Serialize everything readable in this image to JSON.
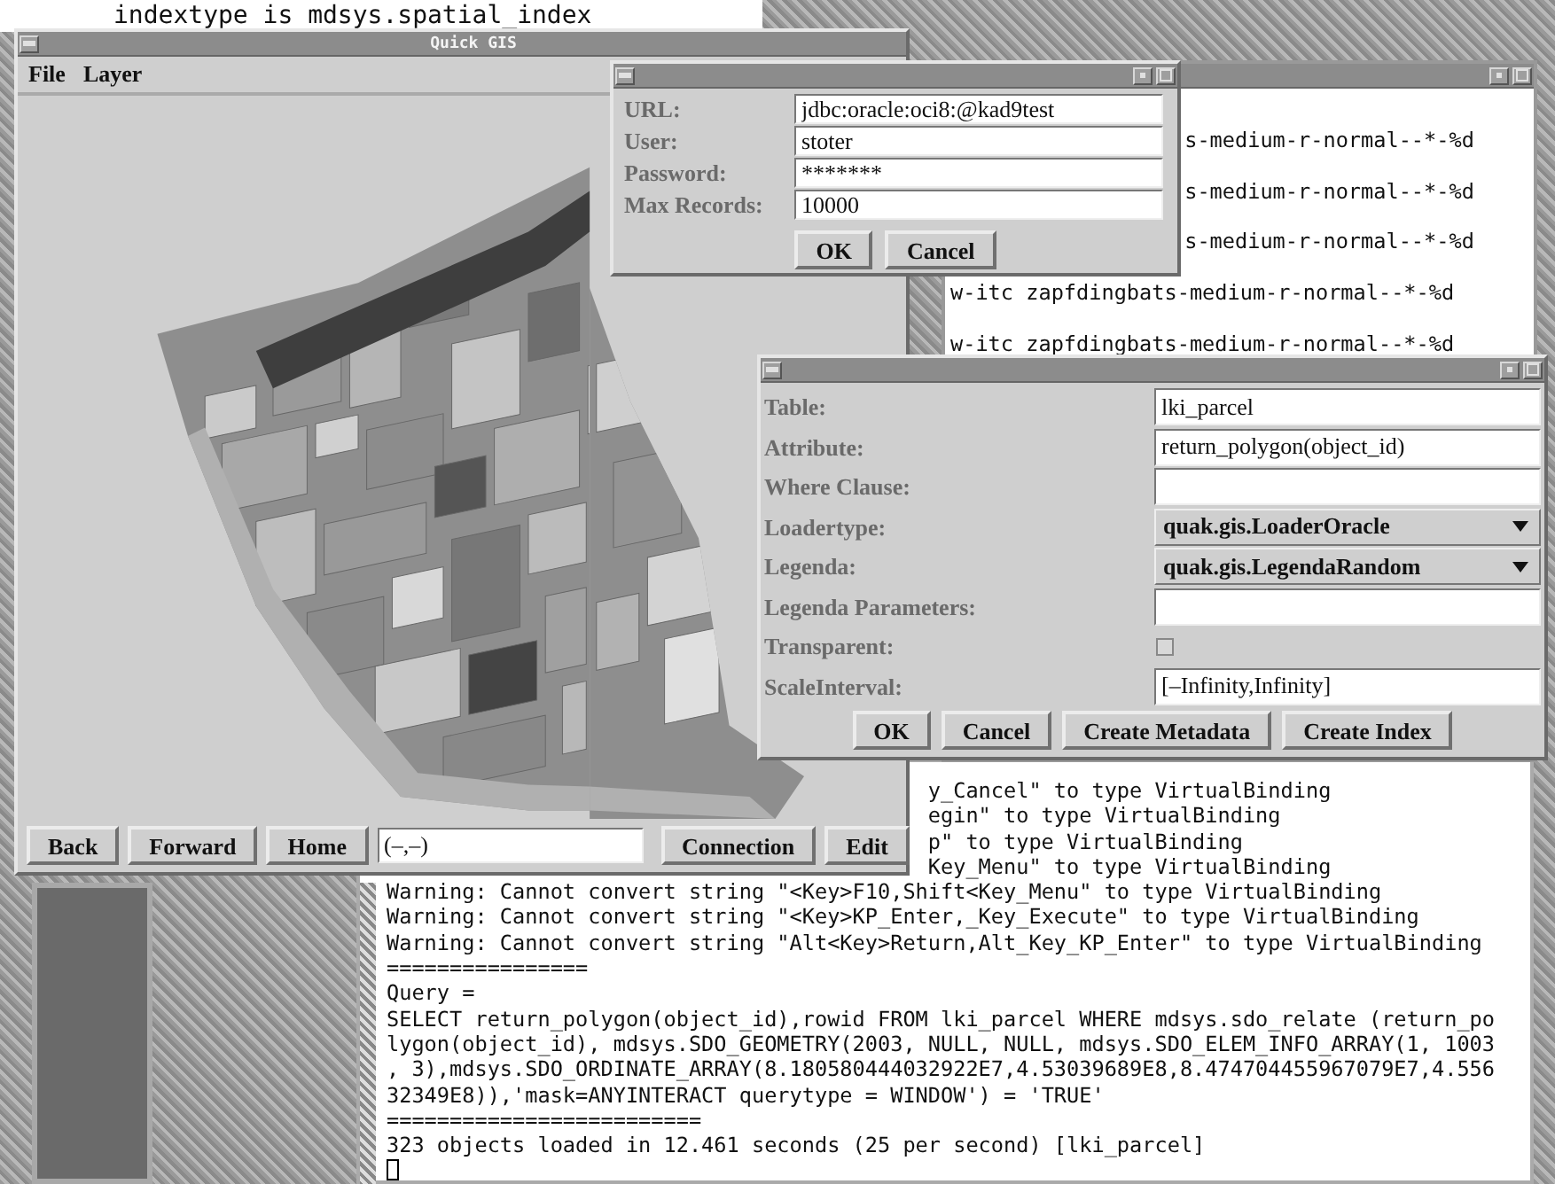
{
  "top_terminal": {
    "lines": [
      "indextype is mdsys.spatial_index"
    ]
  },
  "log_terminal": {
    "lines": [
      {
        "kind": "partial",
        "text": "y_Cancel\" to type VirtualBinding"
      },
      {
        "kind": "partial",
        "text": "egin\" to type VirtualBinding"
      },
      {
        "kind": "partial",
        "text": "p\" to type VirtualBinding"
      },
      {
        "kind": "partial",
        "text": "Key_Menu\" to type VirtualBinding"
      },
      {
        "kind": "full",
        "text": "Warning: Cannot convert string \"<Key>F10,Shift<Key_Menu\" to type VirtualBinding"
      },
      {
        "kind": "full",
        "text": "Warning: Cannot convert string \"<Key>KP_Enter,_Key_Execute\" to type VirtualBinding"
      },
      {
        "kind": "full",
        "text": "Warning: Cannot convert string \"Alt<Key>Return,Alt_Key_KP_Enter\" to type VirtualBinding"
      },
      {
        "kind": "full",
        "text": "================"
      },
      {
        "kind": "full",
        "text": "Query ="
      },
      {
        "kind": "full",
        "text": "SELECT return_polygon(object_id),rowid FROM lki_parcel WHERE mdsys.sdo_relate (return_po"
      },
      {
        "kind": "full",
        "text": "lygon(object_id), mdsys.SDO_GEOMETRY(2003, NULL, NULL, mdsys.SDO_ELEM_INFO_ARRAY(1, 1003"
      },
      {
        "kind": "full",
        "text": ", 3),mdsys.SDO_ORDINATE_ARRAY(8.180580444032922E7,4.53039689E8,8.474704455967079E7,4.556"
      },
      {
        "kind": "full",
        "text": "32349E8)),'mask=ANYINTERACT querytype = WINDOW') = 'TRUE'"
      },
      {
        "kind": "full",
        "text": "========================="
      },
      {
        "kind": "full",
        "text": "323 objects loaded in 12.461 seconds (25 per second) [lki_parcel]"
      },
      {
        "kind": "cursor"
      }
    ]
  },
  "font_terminal": {
    "lines": [
      {
        "kind": "blank"
      },
      {
        "kind": "partial",
        "text": "s-medium-r-normal--*-%d"
      },
      {
        "kind": "blank"
      },
      {
        "kind": "partial",
        "text": "s-medium-r-normal--*-%d"
      },
      {
        "kind": "blank"
      },
      {
        "kind": "partial",
        "text": "s-medium-r-normal--*-%d"
      },
      {
        "kind": "blank"
      },
      {
        "kind": "full",
        "text": "w-itc zapfdingbats-medium-r-normal--*-%d"
      },
      {
        "kind": "blank"
      },
      {
        "kind": "full",
        "text": "w-itc zapfdingbats-medium-r-normal--*-%d"
      }
    ]
  },
  "main_window": {
    "title": "Quick GIS",
    "menu": [
      {
        "label": "File"
      },
      {
        "label": "Layer"
      }
    ],
    "toolbar": {
      "buttons_left": [
        "Back",
        "Forward",
        "Home"
      ],
      "coordinate_field": {
        "value": "(–,–)"
      },
      "buttons_right": [
        "Connection",
        "Edit"
      ]
    }
  },
  "connection_dialog": {
    "fields": [
      {
        "label": "URL:",
        "value": "jdbc:oracle:oci8:@kad9test"
      },
      {
        "label": "User:",
        "value": "stoter"
      },
      {
        "label": "Password:",
        "value": "*******"
      },
      {
        "label": "Max Records:",
        "value": "10000"
      }
    ],
    "buttons": [
      "OK",
      "Cancel"
    ]
  },
  "layer_dialog": {
    "rows": [
      {
        "kind": "text",
        "label": "Table:",
        "value": "lki_parcel"
      },
      {
        "kind": "text",
        "label": "Attribute:",
        "value": "return_polygon(object_id)"
      },
      {
        "kind": "text",
        "label": "Where Clause:"
      },
      {
        "kind": "dropdown",
        "label": "Loadertype:",
        "value": "quak.gis.LoaderOracle"
      },
      {
        "kind": "dropdown",
        "label": "Legenda:",
        "value": "quak.gis.LegendaRandom"
      },
      {
        "kind": "text",
        "label": "Legenda Parameters:"
      },
      {
        "kind": "checkbox",
        "label": "Transparent:",
        "checked": false
      },
      {
        "kind": "text",
        "label": "ScaleInterval:",
        "value": "[–Infinity,Infinity]"
      }
    ],
    "buttons": [
      "OK",
      "Cancel",
      "Create Metadata",
      "Create Index"
    ]
  }
}
